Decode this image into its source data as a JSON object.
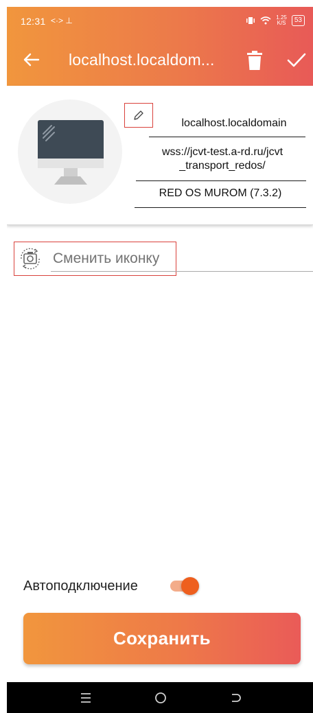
{
  "status_bar": {
    "time": "12:31",
    "left_icons": "<·> ⊥",
    "speed_top": "1.25",
    "speed_bottom": "K/S",
    "battery": "53"
  },
  "app_bar": {
    "title": "localhost.localdom...",
    "back_icon": "arrow-left-icon",
    "delete_icon": "trash-icon",
    "confirm_icon": "check-icon"
  },
  "connection": {
    "host": "localhost.localdomain",
    "url": "wss://jcvt-test.a-rd.ru/jcvt_transport_redos/",
    "url_line1": "wss://jcvt-test.a-rd.ru/jcvt",
    "url_line2": "_transport_redos/",
    "os": "RED OS MUROM (7.3.2)"
  },
  "change_icon": {
    "label": "Сменить иконку"
  },
  "auto_connect": {
    "label": "Автоподключение",
    "enabled": true
  },
  "save_button": {
    "label": "Сохранить"
  },
  "colors": {
    "accent_start": "#f1963d",
    "accent_end": "#e85a57",
    "toggle_knob": "#ee5f1e",
    "highlight_box": "#d9413b"
  }
}
